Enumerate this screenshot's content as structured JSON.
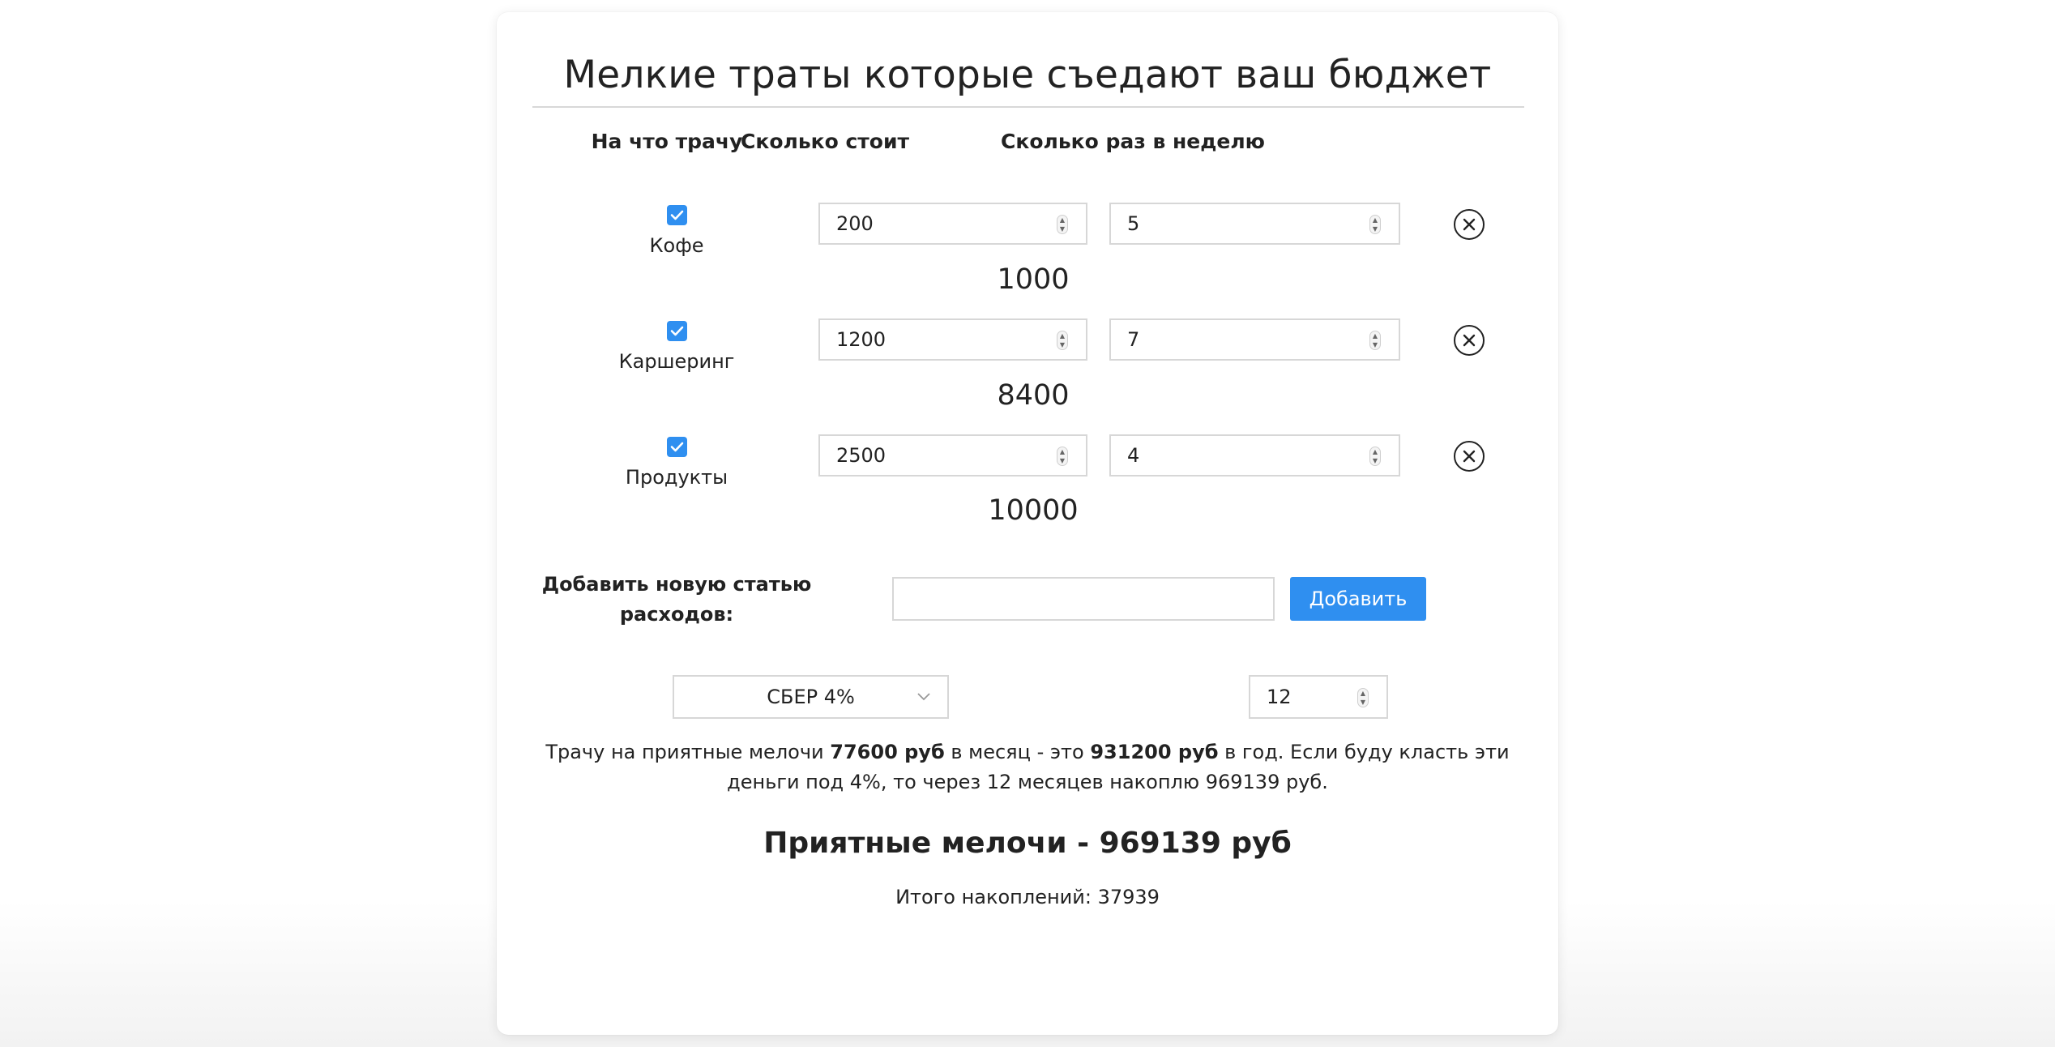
{
  "title": "Мелкие траты которые съедают ваш бюджет",
  "columns": {
    "what": "На что трачу",
    "cost": "Сколько стоит",
    "times": "Сколько раз в неделю"
  },
  "items": [
    {
      "name": "Кофе",
      "checked": true,
      "cost": "200",
      "times": "5",
      "total": "1000"
    },
    {
      "name": "Каршеринг",
      "checked": true,
      "cost": "1200",
      "times": "7",
      "total": "8400"
    },
    {
      "name": "Продукты",
      "checked": true,
      "cost": "2500",
      "times": "4",
      "total": "10000"
    }
  ],
  "add_section": {
    "label": "Добавить новую статью расходов:",
    "input_value": "",
    "button_label": "Добавить"
  },
  "bank_select": {
    "selected": "СБЕР 4%"
  },
  "months_input": {
    "value": "12"
  },
  "summary": {
    "prefix": "Трачу на приятные мелочи",
    "monthly": "77600 руб",
    "middle": "в месяц - это",
    "yearly": "931200 руб",
    "suffix": "в год. Если буду класть эти деньги под 4%, то через 12 месяцев накоплю 969139 руб."
  },
  "headline": "Приятные мелочи - 969139 руб",
  "footer": "Итого накоплений: 37939",
  "colors": {
    "accent": "#2f8ff0",
    "border": "#d7d7d7",
    "text": "#222222"
  },
  "icons": {
    "checkbox": "checkmark-icon",
    "remove": "close-circle-icon",
    "spinner": "spinner-arrows-icon",
    "select": "chevron-down-icon"
  }
}
